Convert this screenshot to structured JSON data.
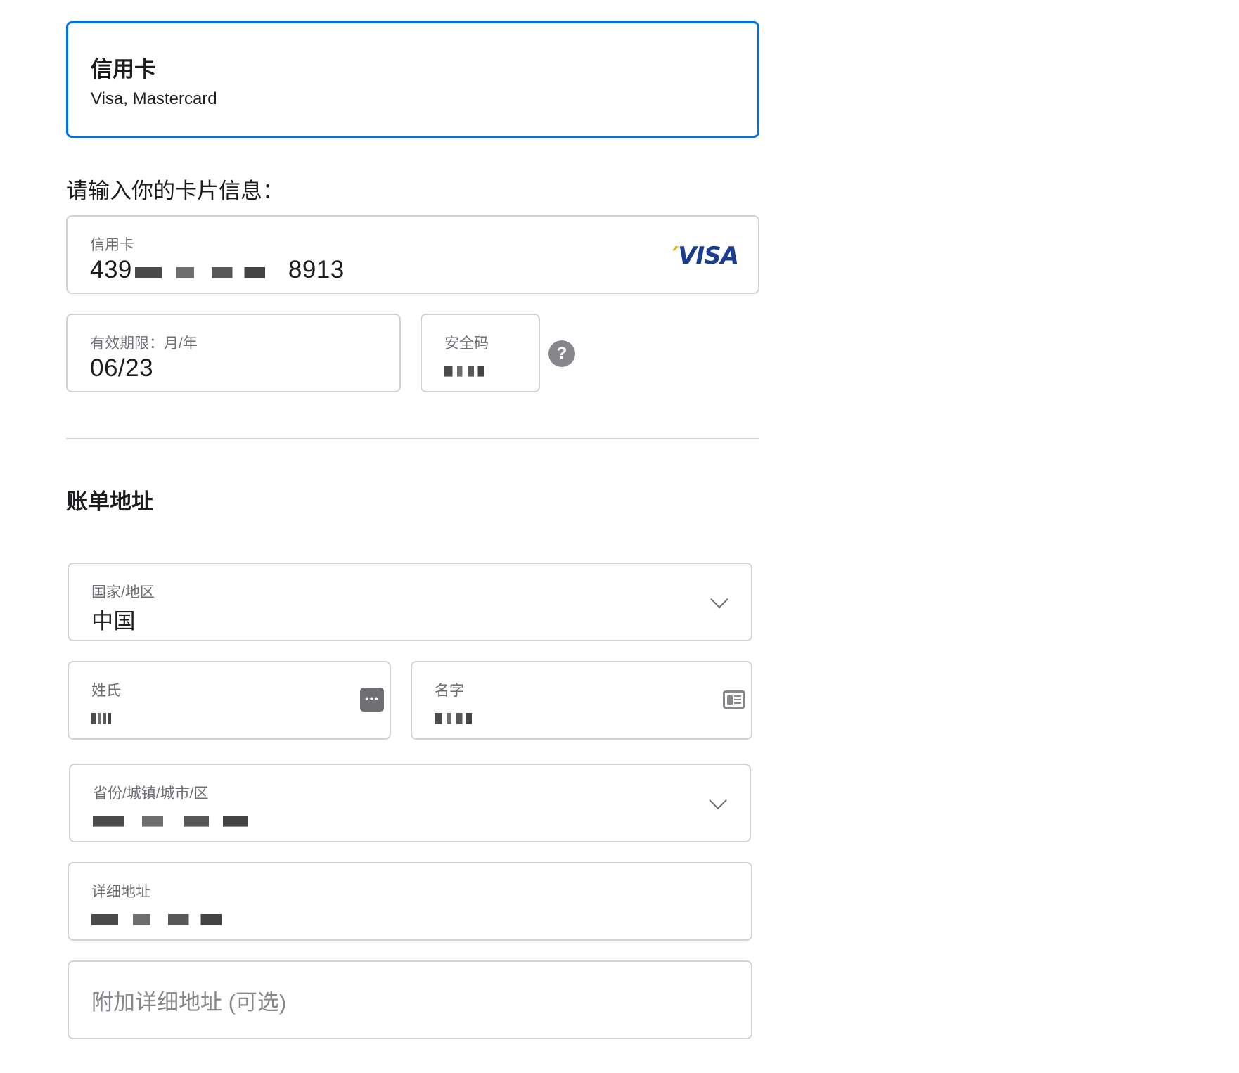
{
  "payment_method": {
    "title": "信用卡",
    "subtitle": "Visa, Mastercard"
  },
  "card_section": {
    "prompt": "请输入你的卡片信息：",
    "card_number": {
      "label": "信用卡",
      "prefix": "439",
      "suffix": "8913",
      "brand": "VISA"
    },
    "expiry": {
      "label": "有效期限：月/年",
      "value": "06/23"
    },
    "cvv": {
      "label": "安全码",
      "help": "?"
    }
  },
  "billing": {
    "title": "账单地址",
    "country": {
      "label": "国家/地区",
      "value": "中国"
    },
    "last_name": {
      "label": "姓氏"
    },
    "first_name": {
      "label": "名字"
    },
    "region": {
      "label": "省份/城镇/城市/区"
    },
    "address": {
      "label": "详细地址"
    },
    "address2": {
      "placeholder": "附加详细地址 (可选)"
    }
  },
  "colors": {
    "accent": "#0071e3",
    "border": "#d2d2d7",
    "muted_text": "#6e6e73",
    "visa_blue": "#1a3d8f"
  },
  "icons": [
    "help-icon",
    "chevron-down-icon",
    "password-keyfill-icon",
    "contact-card-icon",
    "visa-logo"
  ]
}
